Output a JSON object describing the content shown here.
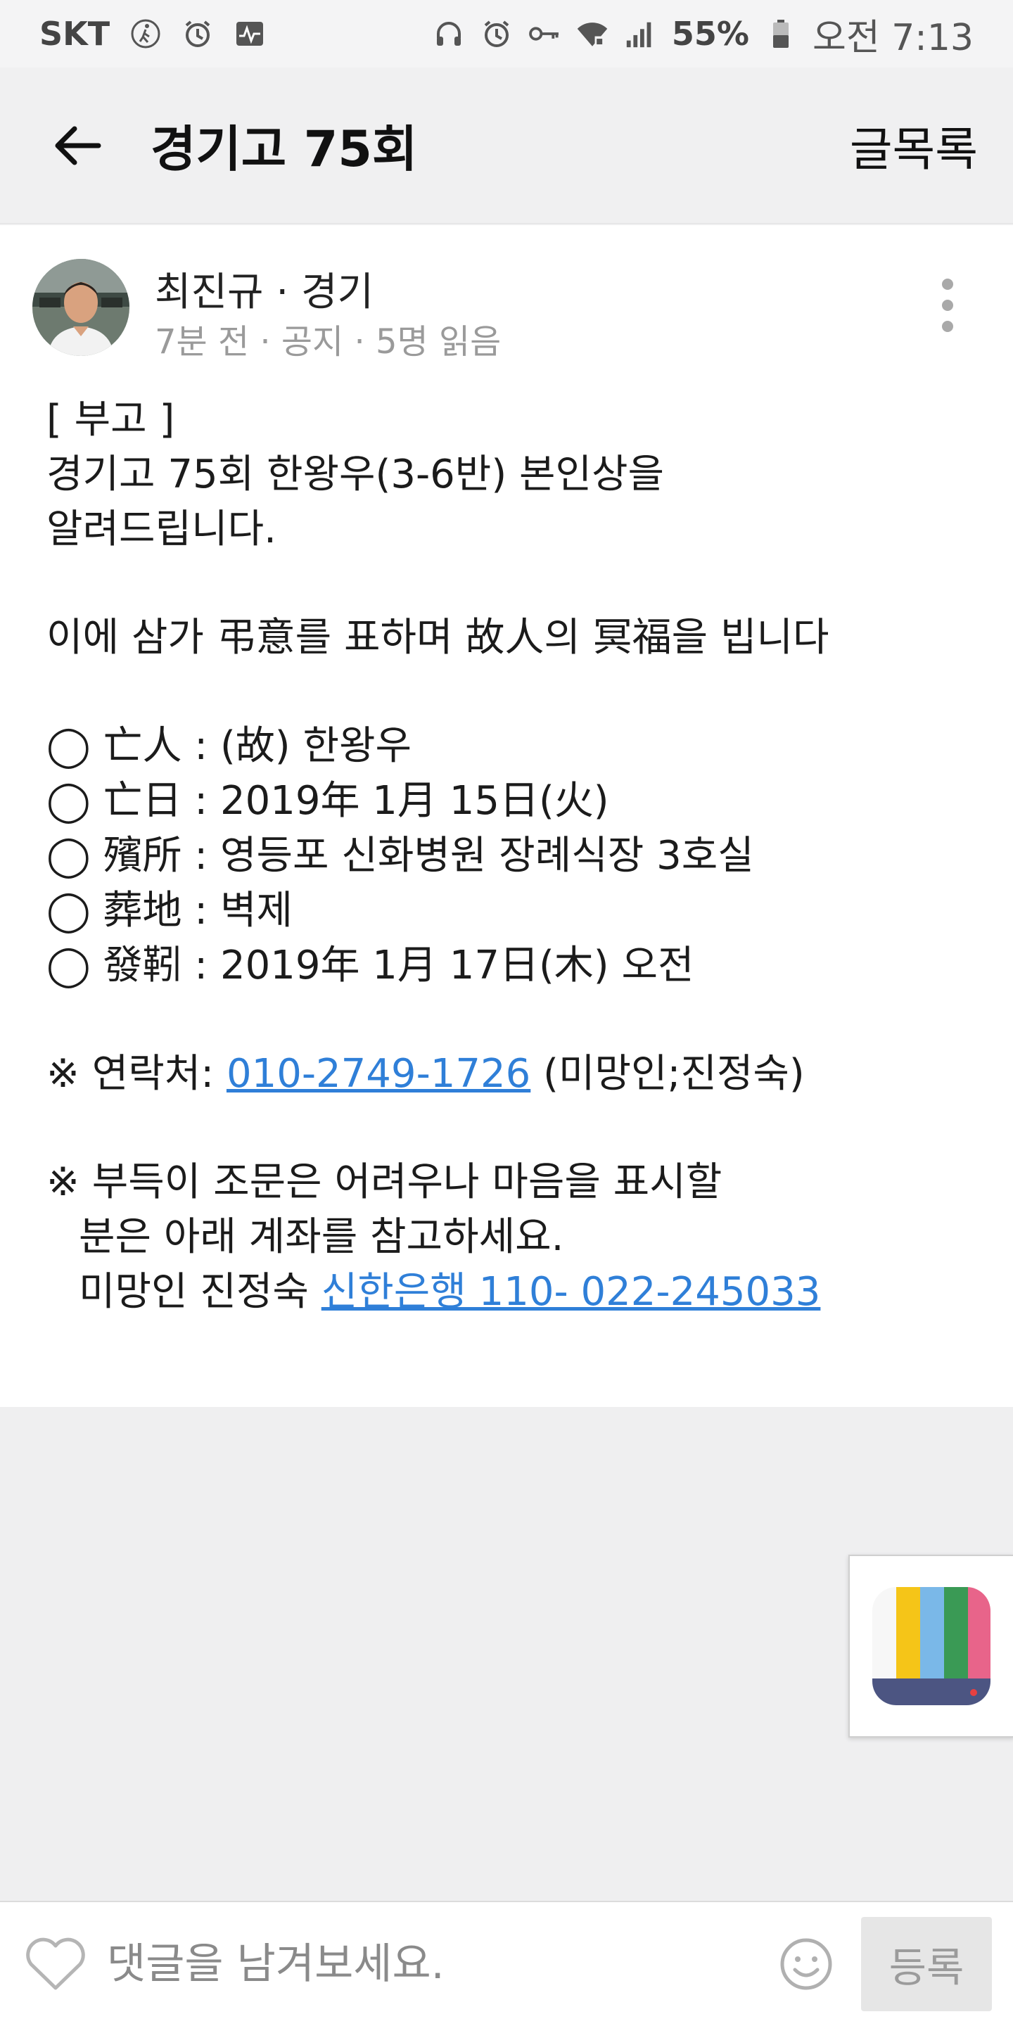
{
  "status_bar": {
    "carrier": "SKT",
    "battery": "55%",
    "time": "오전 7:13",
    "icons": [
      "walking-icon",
      "alarm-icon",
      "pulse-icon",
      "headset-icon",
      "alarm-clock-icon",
      "key-icon",
      "wifi-icon",
      "signal-icon",
      "battery-icon"
    ]
  },
  "app_bar": {
    "title": "경기고 75회",
    "list_label": "글목록"
  },
  "post": {
    "author": "최진규 · 경기",
    "meta": "7분 전 · 공지 · 5명 읽음",
    "lines": {
      "l1": "[ 부고 ]",
      "l2": "경기고 75회 한왕우(3-6반) 본인상을",
      "l3": "알려드립니다.",
      "l4": "이에 삼가 弔意를 표하며 故人의 冥福을 빕니다",
      "l5": "◯ 亡人 : (故) 한왕우",
      "l6": "◯ 亡日 : 2019年 1月 15日(火)",
      "l7": "◯ 殯所 : 영등포 신화병원 장례식장 3호실",
      "l8": "◯ 葬地 : 벽제",
      "l9": "◯ 發靷 : 2019年 1月 17日(木) 오전",
      "contact_prefix": "※ 연락처: ",
      "contact_phone": "010-2749-1726",
      "contact_suffix": " (미망인;진정숙)",
      "l11": "※ 부득이 조문은 어려우나 마음을 표시할",
      "l12": "분은 아래 계좌를 참고하세요.",
      "account_prefix": "미망인 진정숙 ",
      "account_link": "신한은행 110- 022-245033"
    }
  },
  "comment_bar": {
    "placeholder": "댓글을 남겨보세요.",
    "submit_label": "등록"
  },
  "colors": {
    "link": "#2f7fd8",
    "background": "#efeff0"
  }
}
